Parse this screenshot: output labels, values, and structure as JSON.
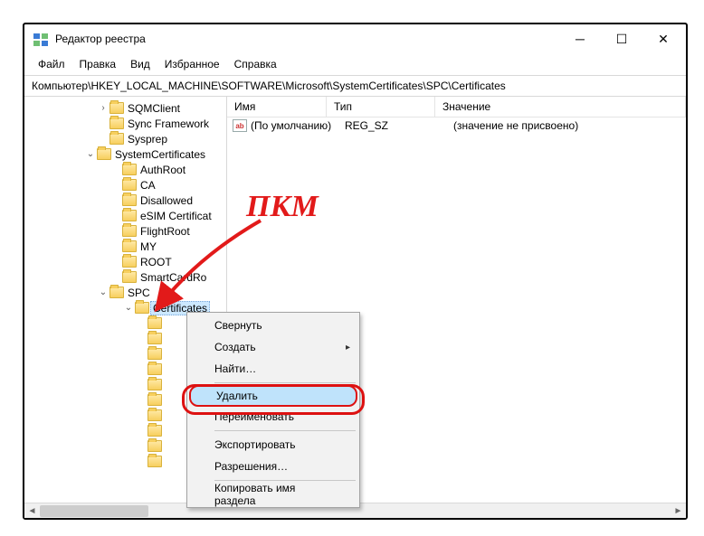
{
  "window": {
    "title": "Редактор реестра"
  },
  "menubar": [
    "Файл",
    "Правка",
    "Вид",
    "Избранное",
    "Справка"
  ],
  "address": "Компьютер\\HKEY_LOCAL_MACHINE\\SOFTWARE\\Microsoft\\SystemCertificates\\SPC\\Certificates",
  "tree": [
    {
      "indent": 80,
      "exp": "closed",
      "label": "SQMClient"
    },
    {
      "indent": 80,
      "exp": "",
      "label": "Sync Framework"
    },
    {
      "indent": 80,
      "exp": "",
      "label": "Sysprep"
    },
    {
      "indent": 66,
      "exp": "open",
      "label": "SystemCertificates"
    },
    {
      "indent": 94,
      "exp": "",
      "label": "AuthRoot"
    },
    {
      "indent": 94,
      "exp": "",
      "label": "CA"
    },
    {
      "indent": 94,
      "exp": "",
      "label": "Disallowed"
    },
    {
      "indent": 94,
      "exp": "",
      "label": "eSIM Certificat"
    },
    {
      "indent": 94,
      "exp": "",
      "label": "FlightRoot"
    },
    {
      "indent": 94,
      "exp": "",
      "label": "MY"
    },
    {
      "indent": 94,
      "exp": "",
      "label": "ROOT"
    },
    {
      "indent": 94,
      "exp": "",
      "label": "SmartCardRo"
    },
    {
      "indent": 80,
      "exp": "open",
      "label": "SPC"
    },
    {
      "indent": 108,
      "exp": "open",
      "label": "Certificates",
      "sel": true
    },
    {
      "indent": 122,
      "exp": "",
      "label": ""
    },
    {
      "indent": 122,
      "exp": "",
      "label": ""
    },
    {
      "indent": 122,
      "exp": "",
      "label": ""
    },
    {
      "indent": 122,
      "exp": "",
      "label": ""
    },
    {
      "indent": 122,
      "exp": "",
      "label": ""
    },
    {
      "indent": 122,
      "exp": "",
      "label": ""
    },
    {
      "indent": 122,
      "exp": "",
      "label": ""
    },
    {
      "indent": 122,
      "exp": "",
      "label": ""
    },
    {
      "indent": 122,
      "exp": "",
      "label": ""
    },
    {
      "indent": 122,
      "exp": "",
      "label": ""
    }
  ],
  "list": {
    "headers": [
      "Имя",
      "Тип",
      "Значение"
    ],
    "rows": [
      {
        "icon": "ab",
        "name": "(По умолчанию)",
        "type": "REG_SZ",
        "value": "(значение не присвоено)"
      }
    ]
  },
  "context_menu": [
    {
      "label": "Свернуть"
    },
    {
      "label": "Создать",
      "submenu": true
    },
    {
      "label": "Найти…"
    },
    {
      "sep": true
    },
    {
      "label": "Удалить",
      "highlight": true
    },
    {
      "label": "Переименовать"
    },
    {
      "sep": true
    },
    {
      "label": "Экспортировать"
    },
    {
      "label": "Разрешения…"
    },
    {
      "sep": true
    },
    {
      "label": "Копировать имя раздела"
    }
  ],
  "annotation": "ПКМ"
}
